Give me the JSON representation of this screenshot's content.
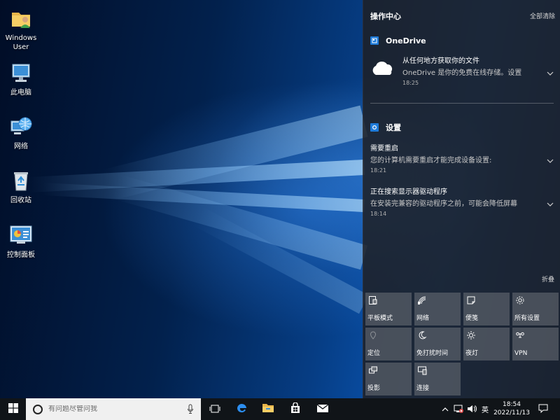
{
  "desktop": {
    "icons": [
      {
        "label": "Windows\nUser",
        "icon": "user-folder-icon"
      },
      {
        "label": "此电脑",
        "icon": "this-pc-icon"
      },
      {
        "label": "网络",
        "icon": "network-globe-icon"
      },
      {
        "label": "回收站",
        "icon": "recycle-bin-icon"
      },
      {
        "label": "控制面板",
        "icon": "control-panel-icon"
      }
    ]
  },
  "action_center": {
    "title": "操作中心",
    "clear_all": "全部清除",
    "collapse": "折叠",
    "groups": [
      {
        "app": "OneDrive",
        "notifications": [
          {
            "title": "从任何地方获取你的文件",
            "body": "OneDrive 是你的免费在线存储。设置",
            "time": "18:25"
          }
        ]
      },
      {
        "app": "设置",
        "notifications": [
          {
            "title": "需要重启",
            "body": "您的计算机需要重启才能完成设备设置:",
            "time": "18:21"
          },
          {
            "title": "正在搜索显示器驱动程序",
            "body": "在安装完兼容的驱动程序之前，可能会降低屏幕",
            "time": "18:14"
          }
        ]
      }
    ],
    "quick_actions": [
      {
        "label": "平板模式",
        "icon": "tablet-mode-icon"
      },
      {
        "label": "网络",
        "icon": "network-icon"
      },
      {
        "label": "便笺",
        "icon": "note-icon"
      },
      {
        "label": "所有设置",
        "icon": "gear-icon"
      },
      {
        "label": "定位",
        "icon": "location-icon"
      },
      {
        "label": "免打扰时间",
        "icon": "moon-icon"
      },
      {
        "label": "夜灯",
        "icon": "brightness-icon"
      },
      {
        "label": "VPN",
        "icon": "vpn-icon"
      },
      {
        "label": "投影",
        "icon": "project-icon"
      },
      {
        "label": "连接",
        "icon": "connect-icon"
      }
    ]
  },
  "taskbar": {
    "search_placeholder": "有问题尽管问我",
    "ime": "英",
    "time": "18:54",
    "date": "2022/11/13"
  },
  "colors": {
    "accent": "#1e7ad8",
    "taskbar": "#101418",
    "action_center_bg": "#1e2024",
    "tile": "#6e737a"
  }
}
